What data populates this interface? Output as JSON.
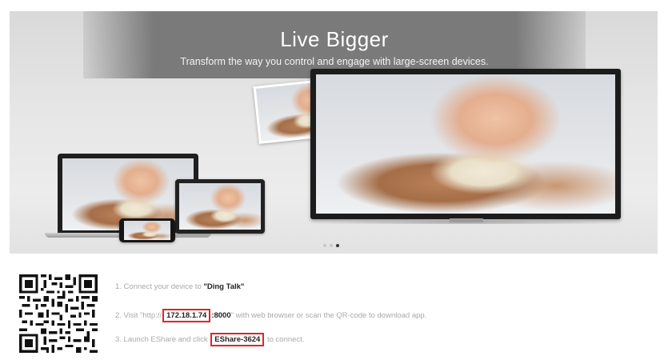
{
  "hero": {
    "title": "Live Bigger",
    "subtitle": "Transform the way you control and engage with large-screen devices.",
    "slides": 3,
    "active_slide": 3
  },
  "instructions": {
    "step1_prefix": "1. Connect your device to ",
    "step1_network": "\"Ding Talk\"",
    "step2_prefix": "2. Visit \"http://",
    "step2_ip": "172.18.1.74",
    "step2_port": ":8000",
    "step2_suffix": "\" with web browser or scan the QR-code to download app.",
    "step3_prefix": "3. Launch EShare and click ",
    "step3_device": "EShare-3624",
    "step3_suffix": " to connect."
  },
  "colors": {
    "highlight": "#e0242a",
    "banner": "#7a7a7a"
  },
  "icons": {
    "qr": "qr-code-icon"
  }
}
